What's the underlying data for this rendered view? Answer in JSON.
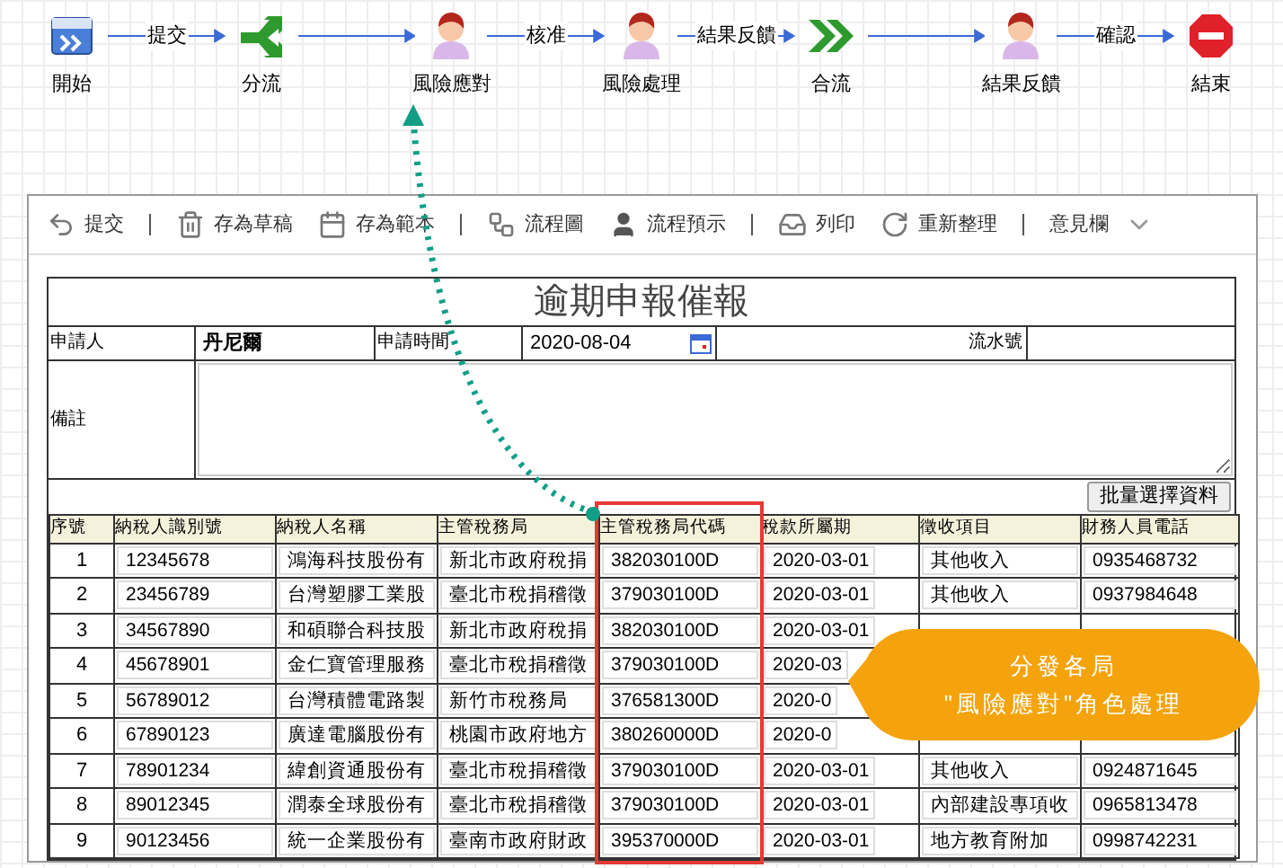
{
  "flow": {
    "nodes": [
      {
        "label": "開始",
        "kind": "start",
        "next_label": "提交"
      },
      {
        "label": "分流",
        "kind": "split"
      },
      {
        "label": "風險應對",
        "kind": "person",
        "next_label": "核准"
      },
      {
        "label": "風險處理",
        "kind": "person",
        "next_label": "結果反饋"
      },
      {
        "label": "合流",
        "kind": "merge"
      },
      {
        "label": "結果反饋",
        "kind": "person",
        "next_label": "確認"
      },
      {
        "label": "結束",
        "kind": "end"
      }
    ]
  },
  "toolbar": [
    {
      "kind": "submit",
      "label": "提交"
    },
    {
      "kind": "separator"
    },
    {
      "kind": "draft",
      "label": "存為草稿"
    },
    {
      "kind": "template",
      "label": "存為範本"
    },
    {
      "kind": "separator"
    },
    {
      "kind": "chart",
      "label": "流程圖"
    },
    {
      "kind": "preview",
      "label": "流程預示"
    },
    {
      "kind": "separator"
    },
    {
      "kind": "print",
      "label": "列印"
    },
    {
      "kind": "refresh",
      "label": "重新整理"
    },
    {
      "kind": "separator"
    },
    {
      "kind": "dropdown",
      "label": "意見欄"
    }
  ],
  "form": {
    "title": "逾期申報催報",
    "applicant_label": "申請人",
    "applicant": "丹尼爾",
    "date_label": "申請時間",
    "date": "2020-08-04",
    "serial_label": "流水號",
    "remark_label": "備註",
    "batch_button": "批量選擇資料"
  },
  "table": {
    "columns": [
      "序號",
      "納稅人識別號",
      "納稅人名稱",
      "主管稅務局",
      "主管稅務局代碼",
      "稅款所屬期",
      "徵收項目",
      "財務人員電話"
    ],
    "rows": [
      [
        "1",
        "12345678",
        "鴻海科技股份有",
        "新北市政府稅捐",
        "382030100D",
        "2020-03-01",
        "其他收入",
        "0935468732"
      ],
      [
        "2",
        "23456789",
        "台灣塑膠工業股",
        "臺北市稅捐稽徵",
        "379030100D",
        "2020-03-01",
        "其他收入",
        "0937984648"
      ],
      [
        "3",
        "34567890",
        "和碩聯合科技股",
        "新北市政府稅捐",
        "382030100D",
        "2020-03-01",
        "",
        ""
      ],
      [
        "4",
        "45678901",
        "金仁寶管理服務",
        "臺北市稅捐稽徵",
        "379030100D",
        "2020-03",
        "",
        ""
      ],
      [
        "5",
        "56789012",
        "台灣積體電路製",
        "新竹市稅務局",
        "376581300D",
        "2020-0",
        "",
        ""
      ],
      [
        "6",
        "67890123",
        "廣達電腦股份有",
        "桃園市政府地方",
        "380260000D",
        "2020-0",
        "",
        ""
      ],
      [
        "7",
        "78901234",
        "緯創資通股份有",
        "臺北市稅捐稽徵",
        "379030100D",
        "2020-03-01",
        "其他收入",
        "0924871645"
      ],
      [
        "8",
        "89012345",
        "潤泰全球股份有",
        "臺北市稅捐稽徵",
        "379030100D",
        "2020-03-01",
        "內部建設專項收",
        "0965813478"
      ],
      [
        "9",
        "90123456",
        "統一企業股份有",
        "臺南市政府財政",
        "395370000D",
        "2020-03-01",
        "地方教育附加",
        "0998742231"
      ]
    ]
  },
  "callout": {
    "lines": [
      "分發各局",
      "\"風險應對\"角色處理"
    ]
  }
}
